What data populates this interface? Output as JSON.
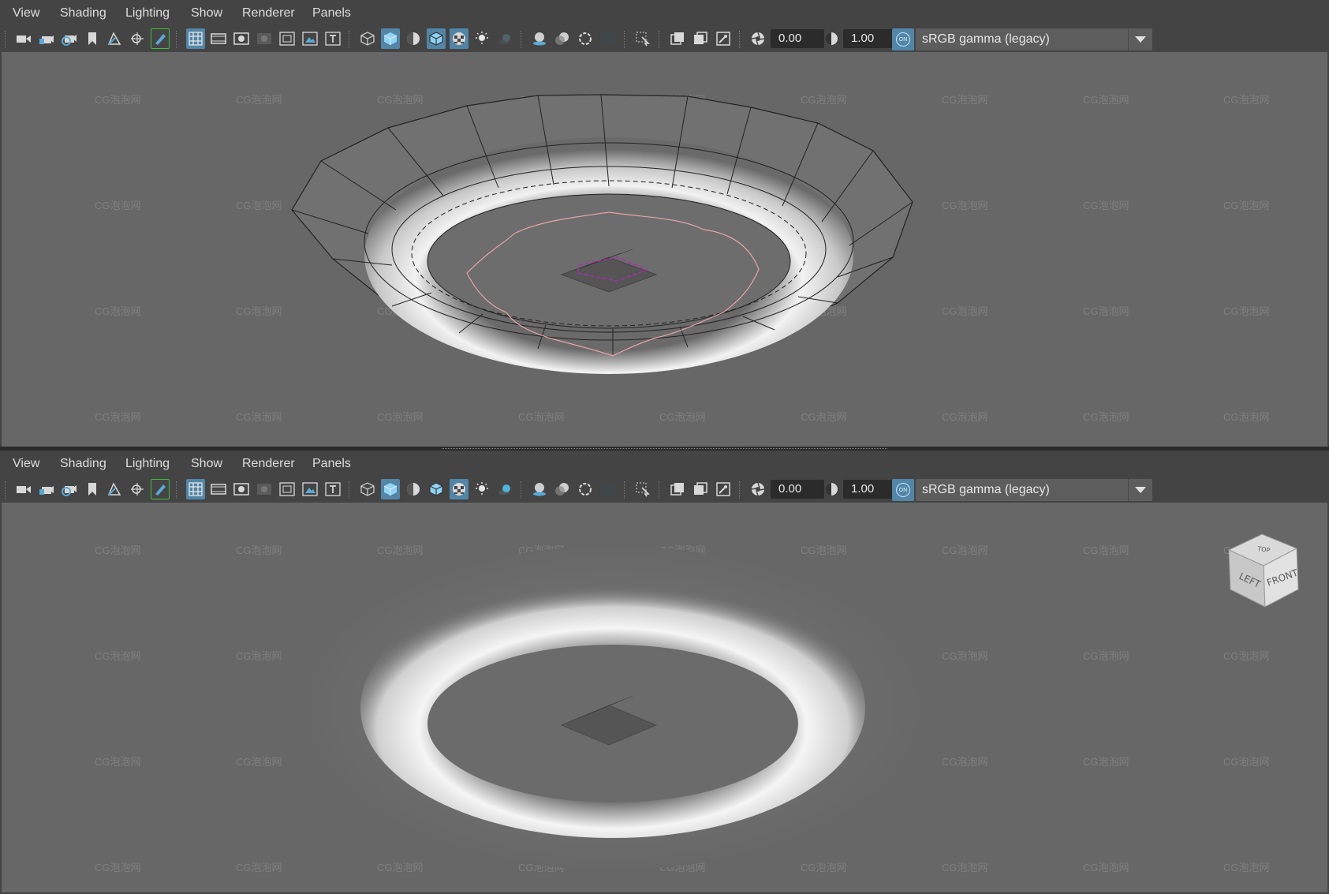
{
  "menu": {
    "view": "View",
    "shading": "Shading",
    "lighting": "Lighting",
    "show": "Show",
    "renderer": "Renderer",
    "panels": "Panels"
  },
  "toolbar": {
    "exposure_value": "0.00",
    "gamma_value": "1.00",
    "color_management_toggle": "ON",
    "view_transform": "sRGB gamma (legacy)"
  },
  "view_cube": {
    "top_label": "TOP",
    "left_label": "LEFT",
    "front_label": "FRONT"
  },
  "watermark": "CG泡泡网",
  "colors": {
    "viewport_bg": "#676767",
    "active_button": "#5285a6",
    "ui_bg": "#444444",
    "selection_highlight": "#c020c0",
    "curve": "#e8a0a0"
  }
}
